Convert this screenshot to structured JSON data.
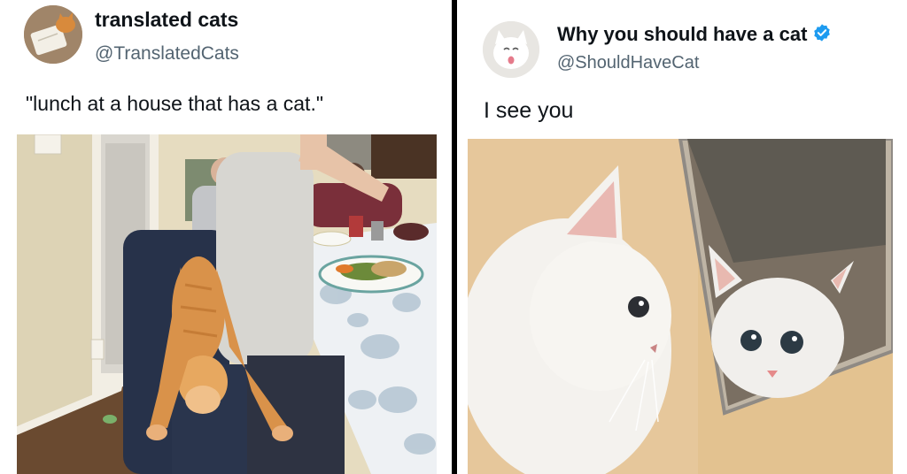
{
  "left_post": {
    "display_name": "translated cats",
    "handle": "@TranslatedCats",
    "text": "\"lunch at a house that has a cat.\"",
    "avatar_icon": "cat-on-book-avatar",
    "photo_desc_icon": "orange-cat-stretched-at-dinner-table-photo"
  },
  "right_post": {
    "display_name": "Why you should have a cat",
    "handle": "@ShouldHaveCat",
    "verified_icon": "verified-badge-icon",
    "text": "I see you",
    "avatar_icon": "white-cat-tongue-avatar",
    "photo_desc_icon": "white-kitten-looking-in-mirror-photo"
  },
  "colors": {
    "name": "#0f1419",
    "handle": "#536471",
    "verified": "#1d9bf0",
    "divider": "#000000"
  }
}
